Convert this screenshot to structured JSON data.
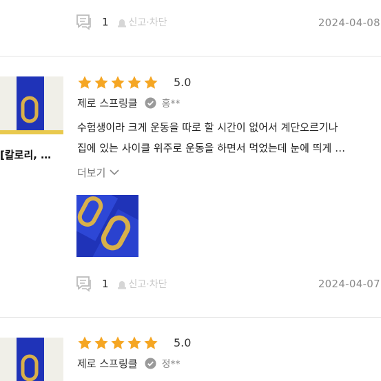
{
  "reviews": [
    {
      "comment_count": "1",
      "report_label": "신고·차단",
      "date": "2024-04-08"
    },
    {
      "side_label": "[칼로리, …",
      "rating": "5.0",
      "product": "제로 스프링클",
      "author": "홍**",
      "text_line1": "수험생이라 크게 운동을 따로 할 시간이 없어서 계단오르기나",
      "text_line2": "집에 있는 사이클 위주로 운동을 하면서 먹었는데 눈에 띄게 …",
      "more_label": "더보기",
      "comment_count": "1",
      "report_label": "신고·차단",
      "date": "2024-04-07"
    },
    {
      "rating": "5.0",
      "product": "제로 스프링클",
      "author": "정**"
    }
  ],
  "colors": {
    "star": "#f5a623",
    "brand_blue": "#1f33b8",
    "gold": "#d8b04a"
  }
}
